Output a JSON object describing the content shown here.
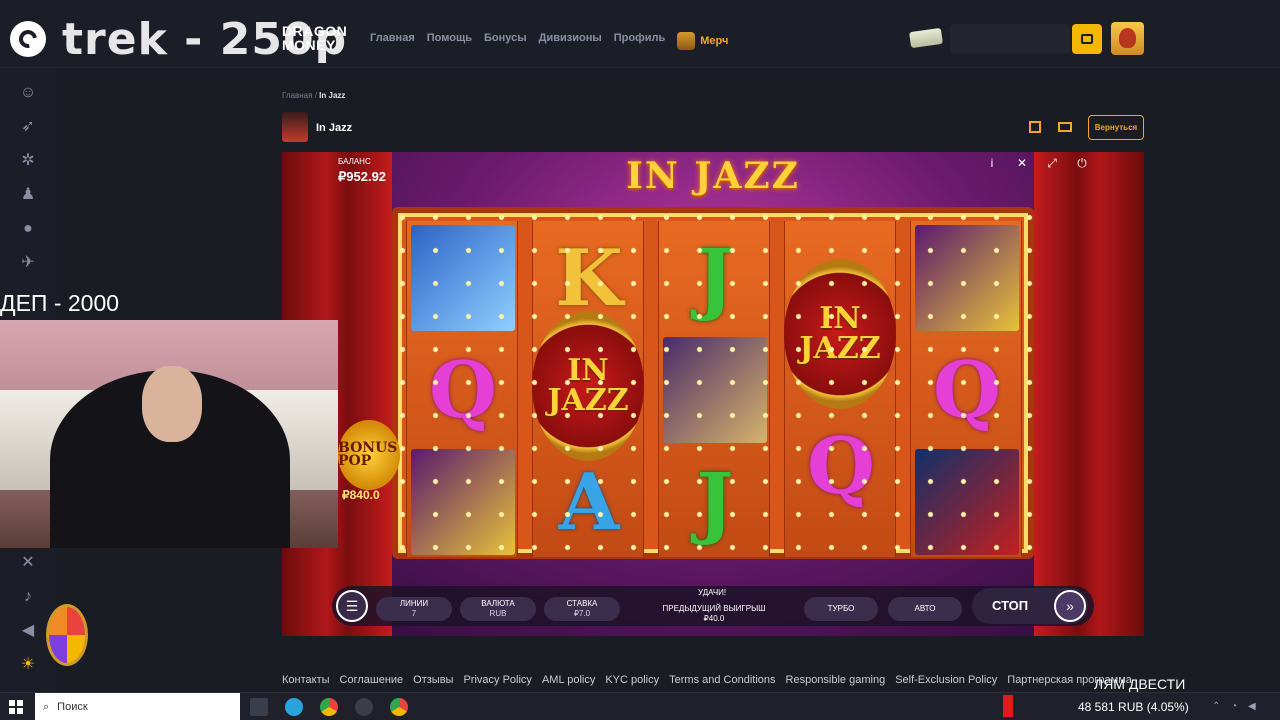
{
  "header": {
    "stream_title": "trek - 250р",
    "brand": "DRAGON MONEY",
    "nav": [
      "Главная",
      "Помощь",
      "Бонусы",
      "Дивизионы",
      "Профиль"
    ],
    "merch": "Мерч"
  },
  "breadcrumb": {
    "home": "Главная",
    "separator": "/",
    "current": "In Jazz"
  },
  "game_header": {
    "name": "In Jazz",
    "back_label": "Вернуться"
  },
  "game": {
    "title": "IN JAZZ",
    "balance_label": "БАЛАНС",
    "balance_value": "₽952.92",
    "wild_text": "IN JAZZ",
    "bonus_pop_label": "BONUS POP",
    "bonus_pop_value": "₽840.0",
    "controls": {
      "lines_label": "ЛИНИИ",
      "lines_value": "7",
      "currency_label": "ВАЛЮТА",
      "currency_value": "RUB",
      "bet_label": "СТАВКА",
      "bet_value": "₽7.0",
      "luck_text": "УДАЧИ!",
      "prev_win_label": "ПРЕДЫДУЩИЙ ВЫИГРЫШ",
      "prev_win_value": "₽40.0",
      "turbo_label": "ТУРБО",
      "auto_label": "АВТО",
      "stop_label": "СТОП"
    }
  },
  "overlay": {
    "deposit_label": "ДЕП -  2000",
    "caption": "ЛЯМ ДВЕСТИ"
  },
  "footer_links": [
    "Контакты",
    "Соглашение",
    "Отзывы",
    "Privacy Policy",
    "AML policy",
    "KYC policy",
    "Terms and Conditions",
    "Responsible gaming",
    "Self-Exclusion Policy",
    "Партнерская программа"
  ],
  "taskbar": {
    "search_placeholder": "Поиск",
    "ticker": "48 581 RUB (4.05%)"
  }
}
